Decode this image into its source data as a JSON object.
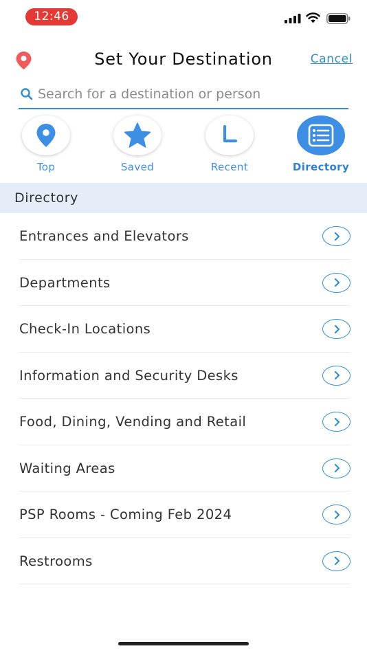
{
  "status_bar": {
    "time": "12:46",
    "time_color": "#e53935",
    "icons": [
      "signal-icon",
      "wifi-icon",
      "battery-icon"
    ]
  },
  "header": {
    "title": "Set Your Destination",
    "cancel_label": "Cancel",
    "pin_icon": "map-pin-icon",
    "pin_color": "#f05a5b"
  },
  "search": {
    "placeholder": "Search for a destination or person",
    "value": "",
    "icon": "search-icon"
  },
  "tabs": [
    {
      "label": "Top",
      "icon": "location-pin-icon",
      "active": false
    },
    {
      "label": "Saved",
      "icon": "star-icon",
      "active": false
    },
    {
      "label": "Recent",
      "icon": "clock-icon",
      "active": false
    },
    {
      "label": "Directory",
      "icon": "list-icon",
      "active": true
    }
  ],
  "section": {
    "title": "Directory"
  },
  "directory": {
    "items": [
      {
        "label": "Entrances and Elevators"
      },
      {
        "label": "Departments"
      },
      {
        "label": "Check-In Locations"
      },
      {
        "label": "Information and Security Desks"
      },
      {
        "label": "Food, Dining, Vending and Retail"
      },
      {
        "label": "Waiting Areas"
      },
      {
        "label": "PSP Rooms - Coming Feb 2024"
      },
      {
        "label": "Restrooms"
      }
    ],
    "chevron_icon": "chevron-right-icon"
  },
  "colors": {
    "accent": "#3d8fe6",
    "link": "#2f8fd6",
    "section_bg": "#e3eef9"
  }
}
